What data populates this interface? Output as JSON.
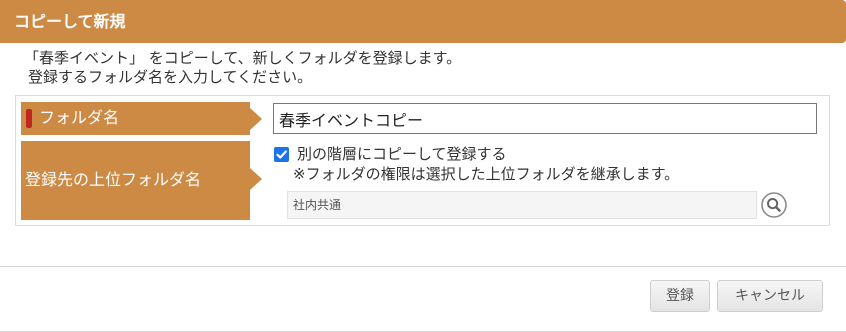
{
  "dialog": {
    "title": "コピーして新規"
  },
  "description": {
    "line1": "「春季イベント」 をコピーして、新しくフォルダを登録します。",
    "line2": "登録するフォルダ名を入力してください。"
  },
  "form": {
    "folder_name": {
      "label": "フォルダ名",
      "value": "春季イベントコピー",
      "required_color": "#c0281f"
    },
    "parent_folder": {
      "label": "登録先の上位フォルダ名",
      "checkbox_label": "別の階層にコピーして登録する",
      "checkbox_checked": true,
      "note": "※フォルダの権限は選択した上位フォルダを継承します。",
      "value": "社内共通"
    }
  },
  "buttons": {
    "register": "登録",
    "cancel": "キャンセル"
  },
  "colors": {
    "accent": "#cd8a45",
    "checkbox": "#1a73e8"
  },
  "icons": {
    "search": "search-icon",
    "check": "check-icon"
  }
}
